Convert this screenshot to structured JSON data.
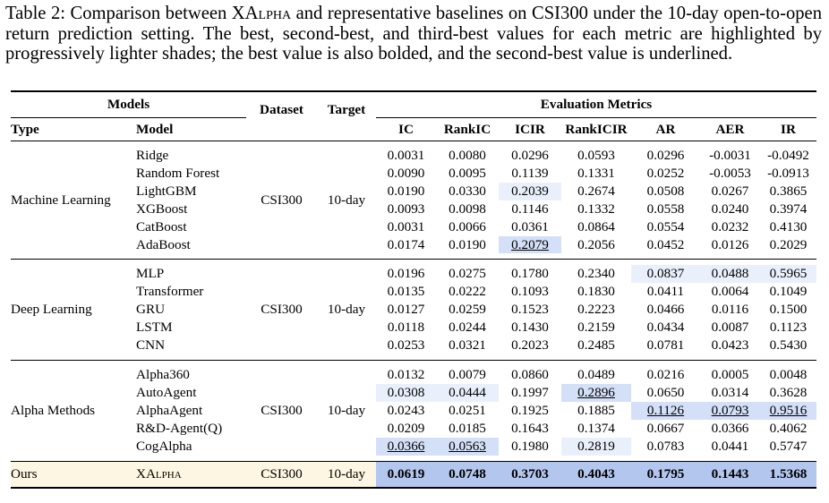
{
  "caption": {
    "lead": "Table 2:  Comparison between ",
    "system_name": "XAlpha",
    "rest": " and representative baselines on CSI300 under the 10-day open-to-open return prediction setting. The best, second-best, and third-best values for each metric are highlighted by progressively lighter shades; the best value is also bolded, and the second-best value is underlined."
  },
  "header": {
    "models": "Models",
    "dataset": "Dataset",
    "target": "Target",
    "eval_metrics": "Evaluation Metrics",
    "type": "Type",
    "model": "Model",
    "metrics": [
      "IC",
      "RankIC",
      "ICIR",
      "RankICIR",
      "AR",
      "AER",
      "IR"
    ]
  },
  "groups": [
    {
      "type": "Machine Learning",
      "dataset": "CSI300",
      "target": "10-day",
      "rows": [
        {
          "model": "Ridge",
          "values": [
            "0.0031",
            "0.0080",
            "0.0296",
            "0.0593",
            "0.0296",
            "-0.0031",
            "-0.0492"
          ],
          "marks": [
            "",
            "",
            "",
            "",
            "",
            "",
            ""
          ]
        },
        {
          "model": "Random Forest",
          "values": [
            "0.0090",
            "0.0095",
            "0.1139",
            "0.1331",
            "0.0252",
            "-0.0053",
            "-0.0913"
          ],
          "marks": [
            "",
            "",
            "",
            "",
            "",
            "",
            ""
          ]
        },
        {
          "model": "LightGBM",
          "values": [
            "0.0190",
            "0.0330",
            "0.2039",
            "0.2674",
            "0.0508",
            "0.0267",
            "0.3865"
          ],
          "marks": [
            "",
            "",
            "s3",
            "",
            "",
            "",
            ""
          ]
        },
        {
          "model": "XGBoost",
          "values": [
            "0.0093",
            "0.0098",
            "0.1146",
            "0.1332",
            "0.0558",
            "0.0240",
            "0.3974"
          ],
          "marks": [
            "",
            "",
            "",
            "",
            "",
            "",
            ""
          ]
        },
        {
          "model": "CatBoost",
          "values": [
            "0.0031",
            "0.0066",
            "0.0361",
            "0.0864",
            "0.0554",
            "0.0232",
            "0.4130"
          ],
          "marks": [
            "",
            "",
            "",
            "",
            "",
            "",
            ""
          ]
        },
        {
          "model": "AdaBoost",
          "values": [
            "0.0174",
            "0.0190",
            "0.2079",
            "0.2056",
            "0.0452",
            "0.0126",
            "0.2029"
          ],
          "marks": [
            "",
            "",
            "s2",
            "",
            "",
            "",
            ""
          ]
        }
      ]
    },
    {
      "type": "Deep Learning",
      "dataset": "CSI300",
      "target": "10-day",
      "rows": [
        {
          "model": "MLP",
          "values": [
            "0.0196",
            "0.0275",
            "0.1780",
            "0.2340",
            "0.0837",
            "0.0488",
            "0.5965"
          ],
          "marks": [
            "",
            "",
            "",
            "",
            "s3",
            "s3",
            "s3"
          ]
        },
        {
          "model": "Transformer",
          "values": [
            "0.0135",
            "0.0222",
            "0.1093",
            "0.1830",
            "0.0411",
            "0.0064",
            "0.1049"
          ],
          "marks": [
            "",
            "",
            "",
            "",
            "",
            "",
            ""
          ]
        },
        {
          "model": "GRU",
          "values": [
            "0.0127",
            "0.0259",
            "0.1523",
            "0.2223",
            "0.0466",
            "0.0116",
            "0.1500"
          ],
          "marks": [
            "",
            "",
            "",
            "",
            "",
            "",
            ""
          ]
        },
        {
          "model": "LSTM",
          "values": [
            "0.0118",
            "0.0244",
            "0.1430",
            "0.2159",
            "0.0434",
            "0.0087",
            "0.1123"
          ],
          "marks": [
            "",
            "",
            "",
            "",
            "",
            "",
            ""
          ]
        },
        {
          "model": "CNN",
          "values": [
            "0.0253",
            "0.0321",
            "0.2023",
            "0.2485",
            "0.0781",
            "0.0423",
            "0.5430"
          ],
          "marks": [
            "",
            "",
            "",
            "",
            "",
            "",
            ""
          ]
        }
      ]
    },
    {
      "type": "Alpha Methods",
      "dataset": "CSI300",
      "target": "10-day",
      "rows": [
        {
          "model": "Alpha360",
          "values": [
            "0.0132",
            "0.0079",
            "0.0860",
            "0.0489",
            "0.0216",
            "0.0005",
            "0.0048"
          ],
          "marks": [
            "",
            "",
            "",
            "",
            "",
            "",
            ""
          ]
        },
        {
          "model": "AutoAgent",
          "values": [
            "0.0308",
            "0.0444",
            "0.1997",
            "0.2896",
            "0.0650",
            "0.0314",
            "0.3628"
          ],
          "marks": [
            "s3",
            "s3",
            "",
            "s2",
            "",
            "",
            ""
          ]
        },
        {
          "model": "AlphaAgent",
          "values": [
            "0.0243",
            "0.0251",
            "0.1925",
            "0.1885",
            "0.1126",
            "0.0793",
            "0.9516"
          ],
          "marks": [
            "",
            "",
            "",
            "",
            "s2",
            "s2",
            "s2"
          ]
        },
        {
          "model": "R&D-Agent(Q)",
          "values": [
            "0.0209",
            "0.0185",
            "0.1643",
            "0.1374",
            "0.0667",
            "0.0366",
            "0.4062"
          ],
          "marks": [
            "",
            "",
            "",
            "",
            "",
            "",
            ""
          ]
        },
        {
          "model": "CogAlpha",
          "values": [
            "0.0366",
            "0.0563",
            "0.1980",
            "0.2819",
            "0.0783",
            "0.0441",
            "0.5747"
          ],
          "marks": [
            "s2",
            "s2",
            "",
            "s3",
            "",
            "",
            ""
          ]
        }
      ]
    }
  ],
  "ours": {
    "type": "Ours",
    "model": "XAlpha",
    "dataset": "CSI300",
    "target": "10-day",
    "values": [
      "0.0619",
      "0.0748",
      "0.3703",
      "0.4043",
      "0.1795",
      "0.1443",
      "1.5368"
    ],
    "marks": [
      "s1",
      "s1",
      "s1",
      "s1",
      "s1",
      "s1",
      "s1"
    ]
  },
  "colors": {
    "best": "#b3c6ee",
    "second": "#d4e0f7",
    "third": "#eaf0fb",
    "ours_row": "#fdf6e2"
  }
}
